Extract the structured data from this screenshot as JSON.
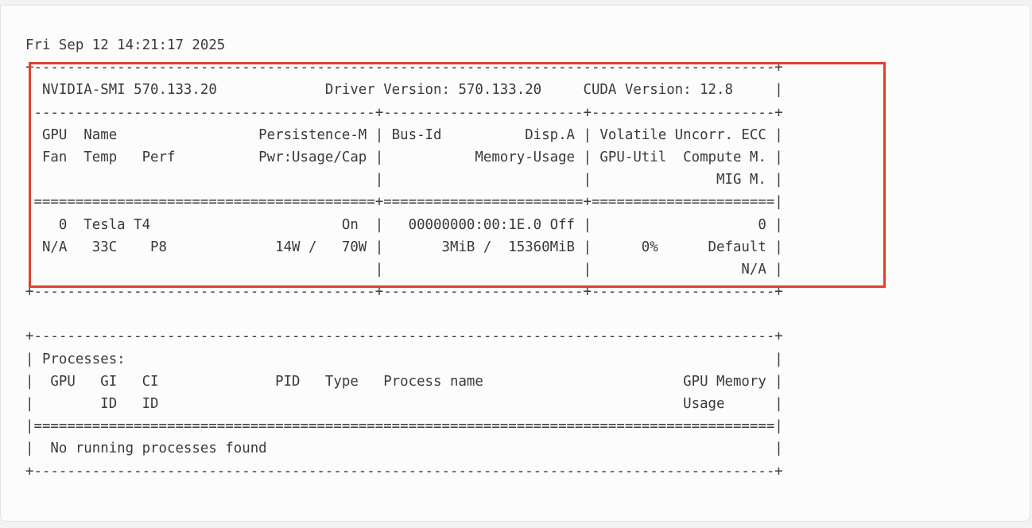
{
  "terminal": {
    "lines": [
      "Fri Sep 12 14:21:17 2025       ",
      "+-----------------------------------------------------------------------------------------+",
      "| NVIDIA-SMI 570.133.20             Driver Version: 570.133.20     CUDA Version: 12.8     |",
      "|-----------------------------------------+------------------------+----------------------+",
      "| GPU  Name                 Persistence-M | Bus-Id          Disp.A | Volatile Uncorr. ECC |",
      "| Fan  Temp   Perf          Pwr:Usage/Cap |           Memory-Usage | GPU-Util  Compute M. |",
      "|                                         |                        |               MIG M. |",
      "|=========================================+========================+======================|",
      "|   0  Tesla T4                       On  |   00000000:00:1E.0 Off |                    0 |",
      "| N/A   33C    P8             14W /   70W |       3MiB /  15360MiB |      0%      Default |",
      "|                                         |                        |                  N/A |",
      "+-----------------------------------------+------------------------+----------------------+",
      "",
      "+-----------------------------------------------------------------------------------------+",
      "| Processes:                                                                              |",
      "|  GPU   GI   CI              PID   Type   Process name                        GPU Memory |",
      "|        ID   ID                                                               Usage      |",
      "|=========================================================================================|",
      "|  No running processes found                                                             |",
      "+-----------------------------------------------------------------------------------------+"
    ]
  },
  "colors": {
    "highlight": "#e0402a",
    "text": "#3a3a3a"
  }
}
